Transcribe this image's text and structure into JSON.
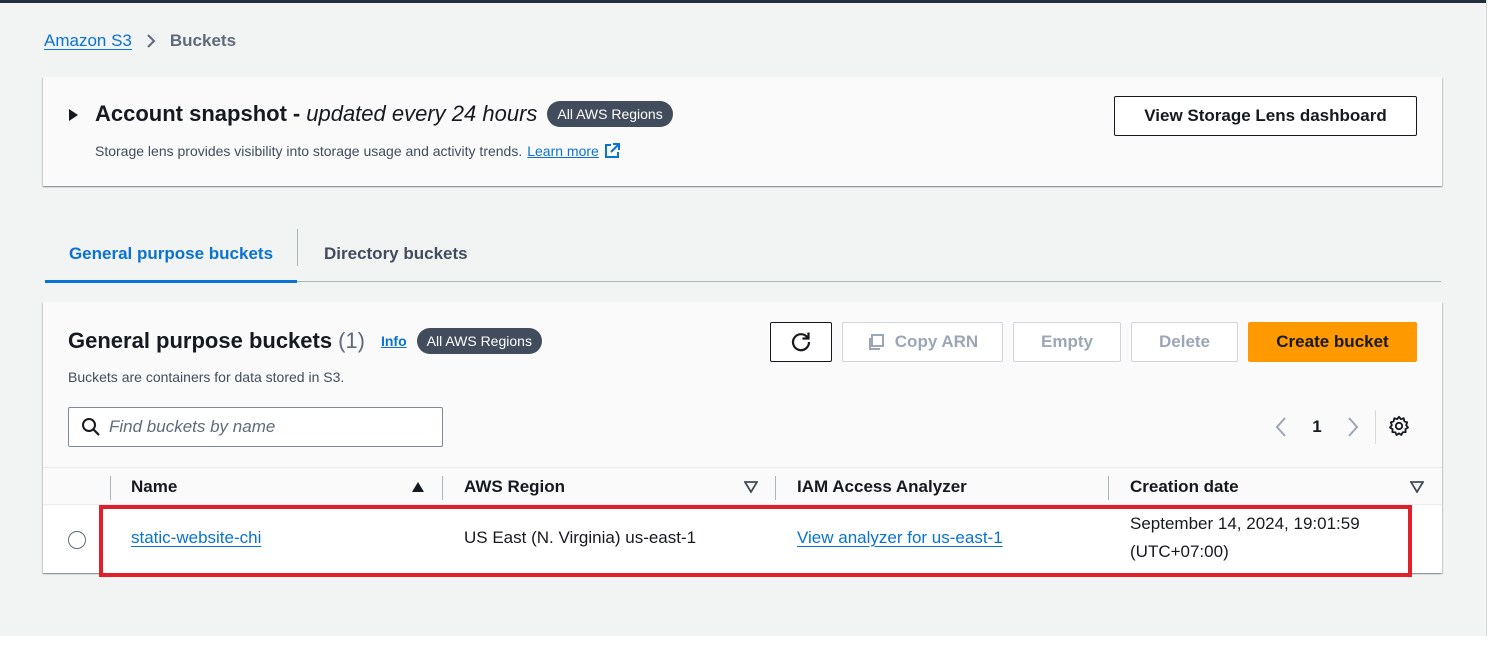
{
  "breadcrumb": {
    "root": "Amazon S3",
    "current": "Buckets"
  },
  "snapshot": {
    "title": "Account snapshot",
    "title_dash": "-",
    "subtitle": "updated every 24 hours",
    "badge": "All AWS Regions",
    "description": "Storage lens provides visibility into storage usage and activity trends.",
    "learn_more": "Learn more",
    "dashboard_button": "View Storage Lens dashboard"
  },
  "tabs": [
    {
      "label": "General purpose buckets",
      "selected": true
    },
    {
      "label": "Directory buckets",
      "selected": false
    }
  ],
  "buckets": {
    "title": "General purpose buckets",
    "count": "(1)",
    "info": "Info",
    "badge": "All AWS Regions",
    "description": "Buckets are containers for data stored in S3.",
    "actions": {
      "copy_arn": "Copy ARN",
      "empty": "Empty",
      "delete": "Delete",
      "create": "Create bucket"
    },
    "search_placeholder": "Find buckets by name",
    "page": "1",
    "columns": [
      "Name",
      "AWS Region",
      "IAM Access Analyzer",
      "Creation date"
    ],
    "rows": [
      {
        "name": "static-website-chi",
        "region": "US East (N. Virginia) us-east-1",
        "analyzer": "View analyzer for us-east-1",
        "created_line1": "September 14, 2024, 19:01:59",
        "created_line2": "(UTC+07:00)"
      }
    ]
  },
  "colors": {
    "link": "#0972d3",
    "primary": "#ff9900",
    "badge": "#414d5c",
    "highlight": "#e0202a"
  }
}
